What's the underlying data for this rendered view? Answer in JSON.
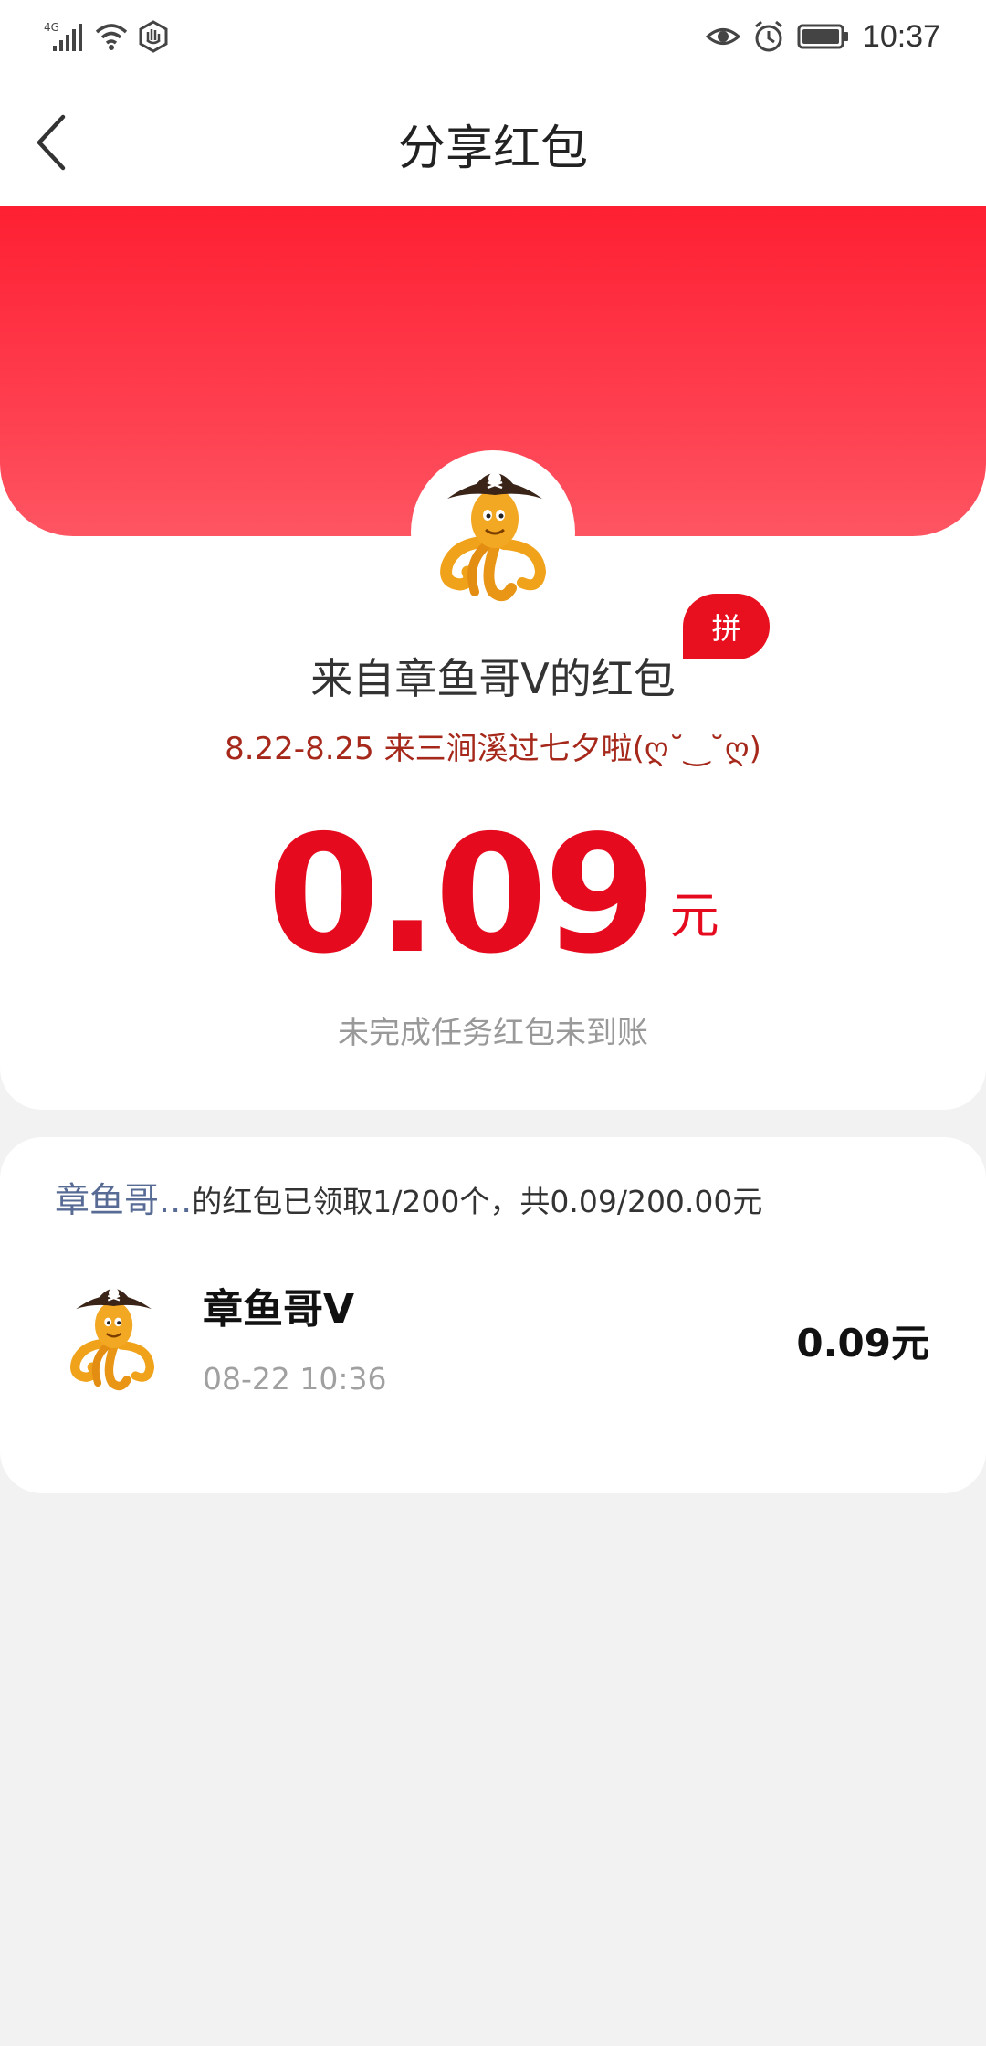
{
  "status_bar": {
    "network": "4G",
    "time": "10:37",
    "icons": [
      "signal-icon",
      "wifi-icon",
      "hand-icon",
      "eye-icon",
      "alarm-icon",
      "battery-icon"
    ]
  },
  "header": {
    "title": "分享红包",
    "back_icon": "chevron-left-icon"
  },
  "packet": {
    "badge": "拼",
    "from_title": "来自章鱼哥V的红包",
    "blessing": "8.22-8.25 来三涧溪过七夕啦(ღ˘‿˘ღ)",
    "amount": "0.09",
    "unit": "元",
    "note": "未完成任务红包未到账"
  },
  "records": {
    "sender_short": "章鱼哥...",
    "summary_rest": "的红包已领取1/200个，共0.09/200.00元",
    "items": [
      {
        "name": "章鱼哥V",
        "time": "08-22 10:36",
        "amount": "0.09元"
      }
    ]
  },
  "colors": {
    "red": "#e60a1e",
    "banner_top": "#fe1f32",
    "banner_bottom": "#fe5562",
    "blessing": "#a5281b",
    "link": "#576b95",
    "background": "#f2f2f2"
  }
}
